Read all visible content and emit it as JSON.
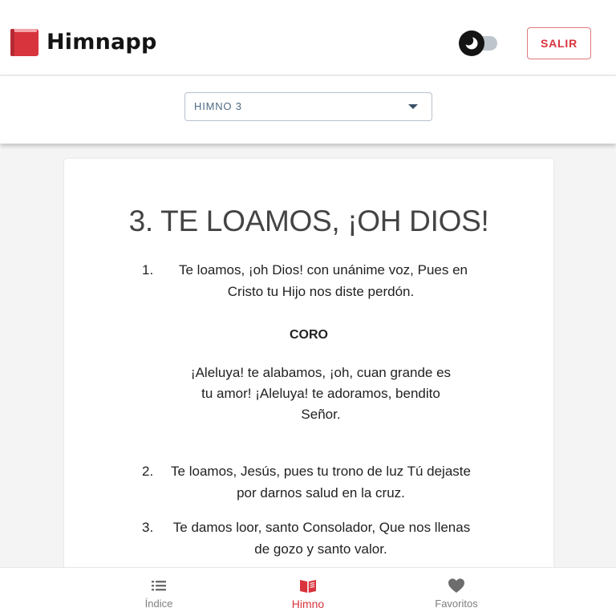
{
  "app": {
    "title": "Himnapp",
    "logout_label": "SALIR"
  },
  "colors": {
    "accent": "#d8343d",
    "logo": "#d8343d",
    "muted": "#7e7e7e"
  },
  "selector": {
    "value": "HIMNO 3"
  },
  "hymn": {
    "title": "3. TE LOAMOS, ¡OH DIOS!",
    "verses": [
      {
        "number": "1.",
        "lines": [
          "Te loamos, ¡oh Dios! con unánime voz, Pues en",
          "Cristo tu Hijo nos diste perdón."
        ]
      },
      {
        "number": "2.",
        "lines": [
          "Te loamos, Jesús, pues tu trono de luz Tú dejaste",
          "por darnos salud en la cruz."
        ]
      },
      {
        "number": "3.",
        "lines": [
          "Te damos loor, santo Consolador, Que nos llenas",
          "de gozo y santo valor."
        ]
      }
    ],
    "chorus": {
      "label": "CORO",
      "lines": [
        "¡Aleluya! te alabamos, ¡oh, cuan grande es",
        "tu amor! ¡Aleluya! te adoramos, bendito",
        "Señor."
      ]
    }
  },
  "nav": {
    "items": [
      {
        "label": "Índice",
        "icon": "list-icon",
        "active": false
      },
      {
        "label": "Himno",
        "icon": "book-icon",
        "active": true
      },
      {
        "label": "Favoritos",
        "icon": "heart-icon",
        "active": false
      }
    ]
  }
}
